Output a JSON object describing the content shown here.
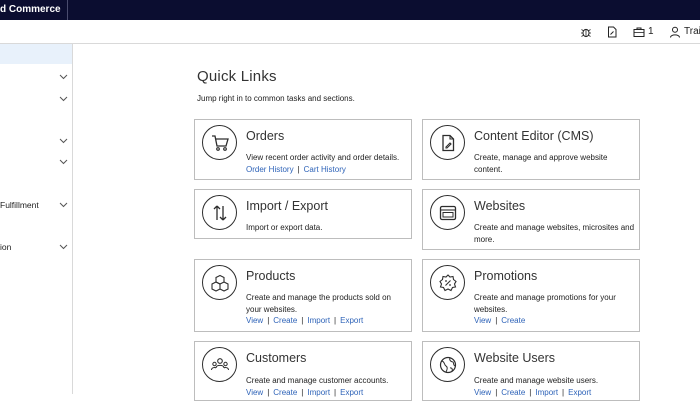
{
  "app": {
    "brand": "d Commerce"
  },
  "toolbar": {
    "cart_count": "1",
    "user_label": "Trai"
  },
  "sidebar": {
    "items": [
      {
        "label": ""
      },
      {
        "label": ""
      },
      {
        "label": ""
      },
      {
        "label": ""
      },
      {
        "label": "Fulfillment"
      },
      {
        "label": "ion"
      }
    ]
  },
  "main": {
    "title": "Quick Links",
    "subtitle": "Jump right in to common tasks and sections."
  },
  "cards": [
    {
      "title": "Orders",
      "icon": "cart-icon",
      "description": "View recent order activity and order details.",
      "links": [
        "Order History",
        "Cart History"
      ]
    },
    {
      "title": "Content Editor (CMS)",
      "icon": "document-edit-icon",
      "description": "Create, manage and approve website content.",
      "links": []
    },
    {
      "title": "Import / Export",
      "icon": "import-export-icon",
      "description": "Import or export data.",
      "links": []
    },
    {
      "title": "Websites",
      "icon": "browser-window-icon",
      "description": "Create and manage websites, microsites and more.",
      "links": []
    },
    {
      "title": "Products",
      "icon": "boxes-icon",
      "description": "Create and manage the products sold on your websites.",
      "links": [
        "View",
        "Create",
        "Import",
        "Export"
      ]
    },
    {
      "title": "Promotions",
      "icon": "discount-badge-icon",
      "description": "Create and manage promotions for your websites.",
      "links": [
        "View",
        "Create"
      ]
    },
    {
      "title": "Customers",
      "icon": "users-icon",
      "description": "Create and manage customer accounts.",
      "links": [
        "View",
        "Create",
        "Import",
        "Export"
      ]
    },
    {
      "title": "Website Users",
      "icon": "globe-icon",
      "description": "Create and manage website users.",
      "links": [
        "View",
        "Create",
        "Import",
        "Export"
      ]
    }
  ],
  "colors": {
    "topbar": "#0b0d30",
    "link": "#2e63b8",
    "sidebar_active": "#e8f1fb"
  }
}
